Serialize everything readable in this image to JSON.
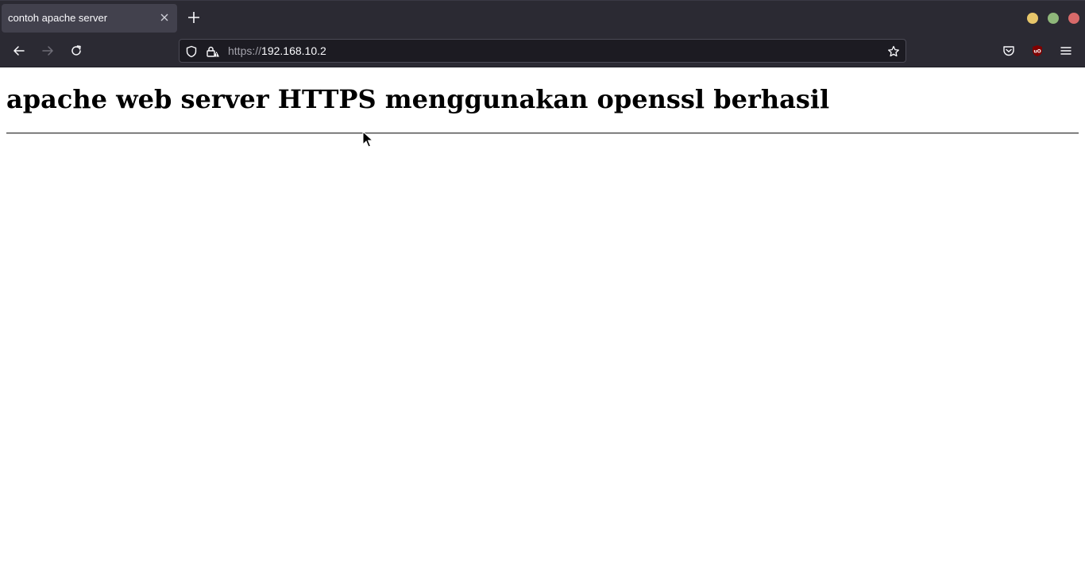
{
  "browser": {
    "tab": {
      "title": "contoh apache server"
    },
    "url": {
      "scheme": "https://",
      "host": "192.168.10.2"
    },
    "window_button_colors": {
      "minimize": "#e7c66a",
      "maximize": "#8fb77a",
      "close": "#d86a6a"
    },
    "icons": {
      "tab_close": "close-icon",
      "new_tab": "plus-icon",
      "back": "arrow-left-icon",
      "forward": "arrow-right-icon",
      "reload": "reload-icon",
      "tracking": "shield-icon",
      "security": "lock-warning-icon",
      "bookmark": "star-icon",
      "pocket": "pocket-icon",
      "extension": "ublock-origin-icon",
      "menu": "hamburger-menu-icon"
    }
  },
  "page": {
    "heading": "apache web server HTTPS menggunakan openssl berhasil"
  }
}
